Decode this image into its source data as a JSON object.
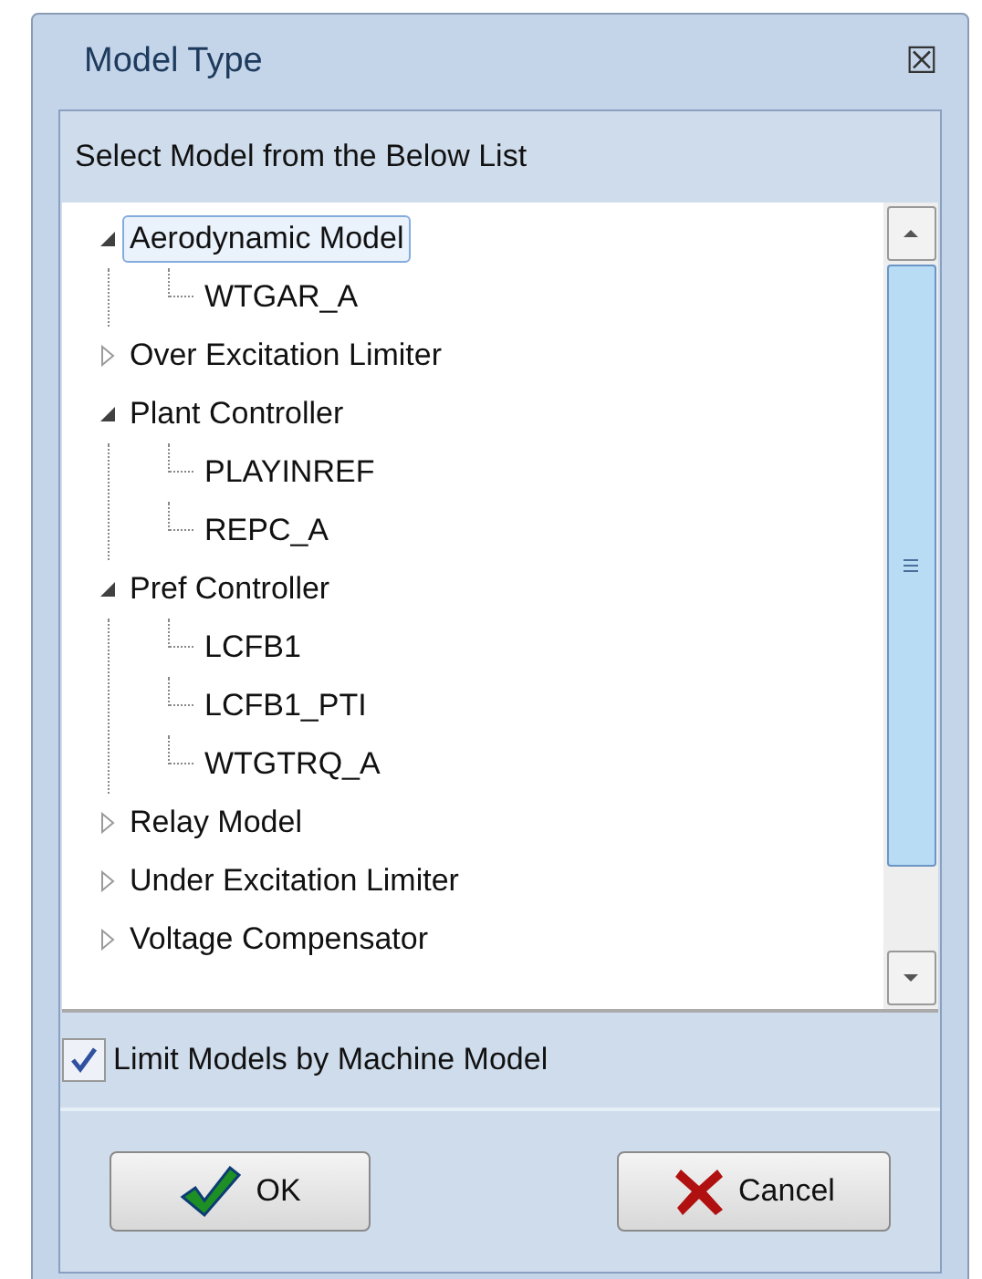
{
  "window": {
    "title": "Model Type",
    "close": "☒"
  },
  "prompt": "Select Model from the Below List",
  "tree": [
    {
      "label": "Aerodynamic Model",
      "expanded": true,
      "selected": true,
      "children": [
        {
          "label": "WTGAR_A",
          "selected": false
        }
      ]
    },
    {
      "label": "Over Excitation Limiter",
      "expanded": false,
      "selected": false
    },
    {
      "label": "Plant Controller",
      "expanded": true,
      "selected": false,
      "children": [
        {
          "label": "PLAYINREF",
          "selected": false
        },
        {
          "label": "REPC_A",
          "selected": false
        }
      ]
    },
    {
      "label": "Pref Controller",
      "expanded": true,
      "selected": false,
      "children": [
        {
          "label": "LCFB1",
          "selected": false
        },
        {
          "label": "LCFB1_PTI",
          "selected": false
        },
        {
          "label": "WTGTRQ_A",
          "selected": false
        }
      ]
    },
    {
      "label": "Relay Model",
      "expanded": false,
      "selected": false
    },
    {
      "label": "Under Excitation Limiter",
      "expanded": false,
      "selected": false
    },
    {
      "label": "Voltage Compensator",
      "expanded": false,
      "selected": false
    }
  ],
  "limit_checkbox": {
    "label": "Limit Models by Machine Model",
    "checked": true
  },
  "buttons": [
    {
      "kind": "ok",
      "label": "OK"
    },
    {
      "kind": "cancel",
      "label": "Cancel"
    }
  ]
}
